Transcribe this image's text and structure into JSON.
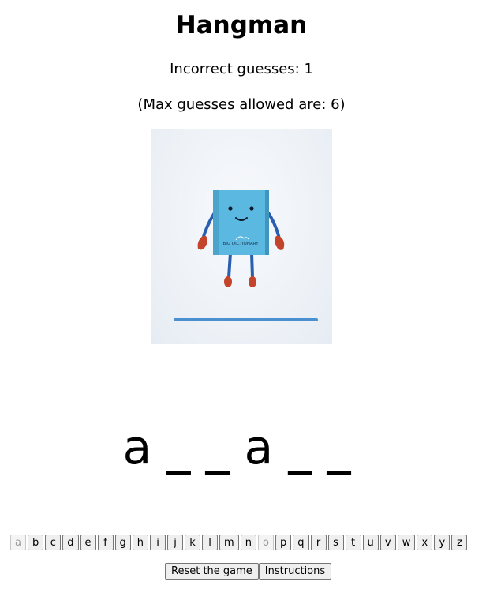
{
  "title": "Hangman",
  "incorrect_guesses_text": "Incorrect guesses: 1",
  "max_guesses_text": "(Max guesses allowed are: 6)",
  "picture": {
    "description_icon": "book-character-icon",
    "book_text": "BIG DICTIONARY",
    "book_color": "#5bb8e0"
  },
  "word_display": "a _ _ a _ _",
  "keyboard": [
    {
      "letter": "a",
      "disabled": true
    },
    {
      "letter": "b",
      "disabled": false
    },
    {
      "letter": "c",
      "disabled": false
    },
    {
      "letter": "d",
      "disabled": false
    },
    {
      "letter": "e",
      "disabled": false
    },
    {
      "letter": "f",
      "disabled": false
    },
    {
      "letter": "g",
      "disabled": false
    },
    {
      "letter": "h",
      "disabled": false
    },
    {
      "letter": "i",
      "disabled": false
    },
    {
      "letter": "j",
      "disabled": false
    },
    {
      "letter": "k",
      "disabled": false
    },
    {
      "letter": "l",
      "disabled": false
    },
    {
      "letter": "m",
      "disabled": false
    },
    {
      "letter": "n",
      "disabled": false
    },
    {
      "letter": "o",
      "disabled": true
    },
    {
      "letter": "p",
      "disabled": false
    },
    {
      "letter": "q",
      "disabled": false
    },
    {
      "letter": "r",
      "disabled": false
    },
    {
      "letter": "s",
      "disabled": false
    },
    {
      "letter": "t",
      "disabled": false
    },
    {
      "letter": "u",
      "disabled": false
    },
    {
      "letter": "v",
      "disabled": false
    },
    {
      "letter": "w",
      "disabled": false
    },
    {
      "letter": "x",
      "disabled": false
    },
    {
      "letter": "y",
      "disabled": false
    },
    {
      "letter": "z",
      "disabled": false
    }
  ],
  "actions": {
    "reset_label": "Reset the game",
    "instructions_label": "Instructions"
  }
}
